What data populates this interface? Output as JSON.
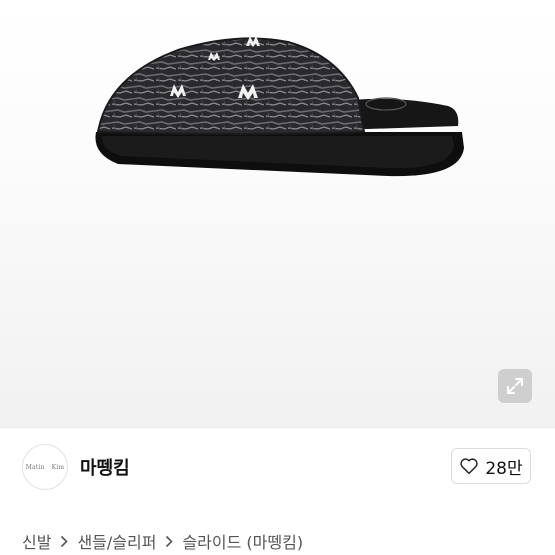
{
  "product": {
    "image_description_icon": "slide-sandal-image",
    "expand_icon": "expand-icon"
  },
  "seller": {
    "avatar_text_left": "Matin",
    "avatar_text_right": "Kim",
    "name": "마뗑킴"
  },
  "like": {
    "icon": "heart-icon",
    "count": "28만"
  },
  "breadcrumb": {
    "items": [
      "신발",
      "샌들/슬리퍼",
      "슬라이드 (마뗑킴)"
    ],
    "separator_icon": "chevron-right-icon"
  }
}
